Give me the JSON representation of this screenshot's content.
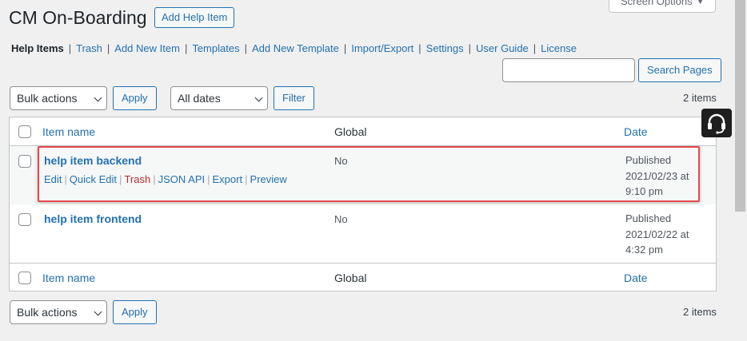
{
  "header": {
    "title": "CM On-Boarding",
    "add_button": "Add Help Item",
    "screen_options": "Screen Options",
    "screen_options_caret": "▼"
  },
  "nav": {
    "separator": "|",
    "items": [
      {
        "label": "Help Items",
        "current": true
      },
      {
        "label": "Trash",
        "current": false
      },
      {
        "label": "Add New Item",
        "current": false
      },
      {
        "label": "Templates",
        "current": false
      },
      {
        "label": "Add New Template",
        "current": false
      },
      {
        "label": "Import/Export",
        "current": false
      },
      {
        "label": "Settings",
        "current": false
      },
      {
        "label": "User Guide",
        "current": false
      },
      {
        "label": "License",
        "current": false
      }
    ]
  },
  "search": {
    "value": "",
    "button": "Search Pages"
  },
  "tablenav_top": {
    "bulk_actions": "Bulk actions",
    "apply": "Apply",
    "dates": "All dates",
    "filter": "Filter",
    "count": "2 items"
  },
  "table": {
    "columns": {
      "name": "Item name",
      "global": "Global",
      "date": "Date"
    },
    "rows": [
      {
        "title": "help item backend",
        "global": "No",
        "date_status": "Published",
        "date_line1": "2021/02/23 at",
        "date_line2": "9:10 pm",
        "actions": [
          "Edit",
          "Quick Edit",
          "Trash",
          "JSON API",
          "Export",
          "Preview"
        ]
      },
      {
        "title": "help item frontend",
        "global": "No",
        "date_status": "Published",
        "date_line1": "2021/02/22 at",
        "date_line2": "4:32 pm"
      }
    ]
  },
  "tablenav_bottom": {
    "bulk_actions": "Bulk actions",
    "apply": "Apply",
    "count": "2 items"
  },
  "colors": {
    "link": "#2271b1",
    "trash": "#b32d2e",
    "highlight": "#e5484d",
    "page_bg": "#f0f0f1"
  },
  "icons": {
    "support": "headset-icon"
  }
}
